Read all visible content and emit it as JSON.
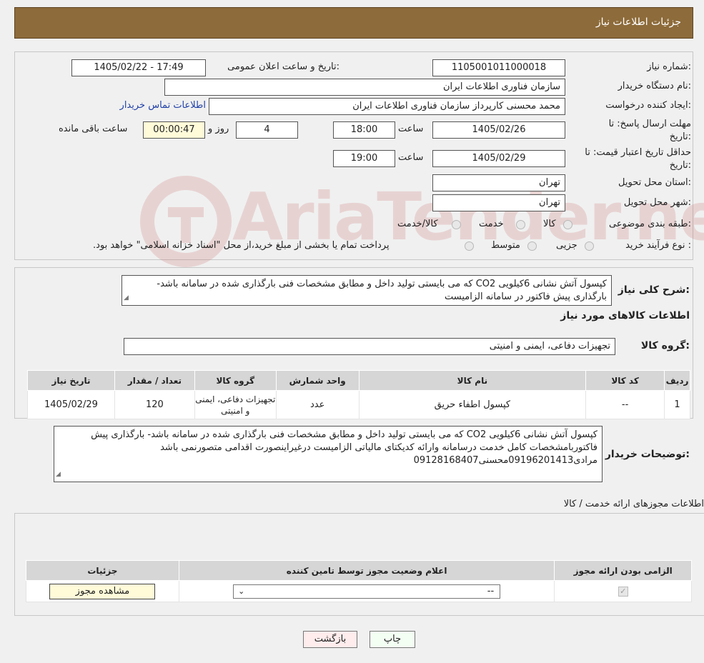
{
  "header": {
    "title": "جزئیات اطلاعات نیاز"
  },
  "info": {
    "need_number_label": "شماره نیاز:",
    "need_number": "1105001011000018",
    "announce_label": "تاریخ و ساعت اعلان عمومی:",
    "announce_value": "1405/02/22 - 17:49",
    "buyer_org_label": "نام دستگاه خریدار:",
    "buyer_org": "سازمان فناوری اطلاعات ایران",
    "creator_label": "ایجاد کننده درخواست:",
    "creator": "محمد محسنی کارپرداز سازمان فناوری اطلاعات ایران",
    "contact_link": "اطلاعات تماس خریدار",
    "deadline_label_1": "مهلت ارسال پاسخ: تا",
    "deadline_label_2": "تاریخ:",
    "deadline_date": "1405/02/26",
    "time_label": "ساعت",
    "deadline_time": "18:00",
    "days_value": "4",
    "days_label": "روز و",
    "remaining_value": "00:00:47",
    "remaining_label": "ساعت باقی مانده",
    "validity_label_1": "حداقل تاریخ اعتبار قیمت: تا",
    "validity_label_2": "تاریخ:",
    "validity_date": "1405/02/29",
    "validity_time": "19:00",
    "province_label": "استان محل تحویل:",
    "province": "تهران",
    "city_label": "شهر محل تحویل:",
    "city": "تهران",
    "category_label": "طبقه بندی موضوعی:",
    "category_options": [
      "کالا",
      "خدمت",
      "کالا/خدمت"
    ],
    "purchase_type_label": "نوع فرآیند خرید :",
    "purchase_options": [
      "جزیی",
      "متوسط"
    ],
    "purchase_note": "پرداخت تمام یا بخشی از مبلغ خرید،از محل \"اسناد خزانه اسلامی\" خواهد بود."
  },
  "watermark": {
    "text": "AriaTender.neT",
    "color": "#c86c6c"
  },
  "description": {
    "label": "شرح کلی نیاز:",
    "text": "کپسول آتش نشانی 6کیلویی CO2 که می بایستی تولید داخل و مطابق مشخصات فنی بارگذاری شده در سامانه باشد- بارگذاری پیش فاکتور در سامانه الزامیست",
    "goods_info_title": "اطلاعات کالاهای مورد نیاز",
    "goods_group_label": "گروه کالا:",
    "goods_group": "تجهیزات دفاعی، ایمنی و امنیتی"
  },
  "goods_table": {
    "headers": [
      "ردیف",
      "کد کالا",
      "نام کالا",
      "واحد شمارش",
      "گروه کالا",
      "تعداد / مقدار",
      "تاریخ نیاز"
    ],
    "rows": [
      [
        "1",
        "--",
        "کپسول اطفاء حریق",
        "عدد",
        "تجهیزات دفاعی، ایمنی و امنیتی",
        "120",
        "1405/02/29"
      ]
    ]
  },
  "buyer_notes": {
    "label": "توضیحات خریدار:",
    "text": "کپسول آتش نشانی 6کیلویی CO2 که می بایستی تولید داخل و مطابق مشخصات فنی بارگذاری شده در سامانه باشد- بارگذاری پیش فاکتوربامشخصات کامل خدمت درسامانه وارائه کدیکتای مالیاتی الزامیست درغیراینصورت اقدامی متصورنمی باشد مرادی09196201413محسنی09128168407"
  },
  "permits": {
    "title": "اطلاعات مجوزهای ارائه خدمت / کالا",
    "headers": [
      "الزامی بودن ارائه مجوز",
      "اعلام وضعیت مجوز توسط تامین کننده",
      "جزئیات"
    ],
    "select_value": "--",
    "view_button": "مشاهده مجوز"
  },
  "actions": {
    "print": "چاپ",
    "back": "بازگشت"
  }
}
